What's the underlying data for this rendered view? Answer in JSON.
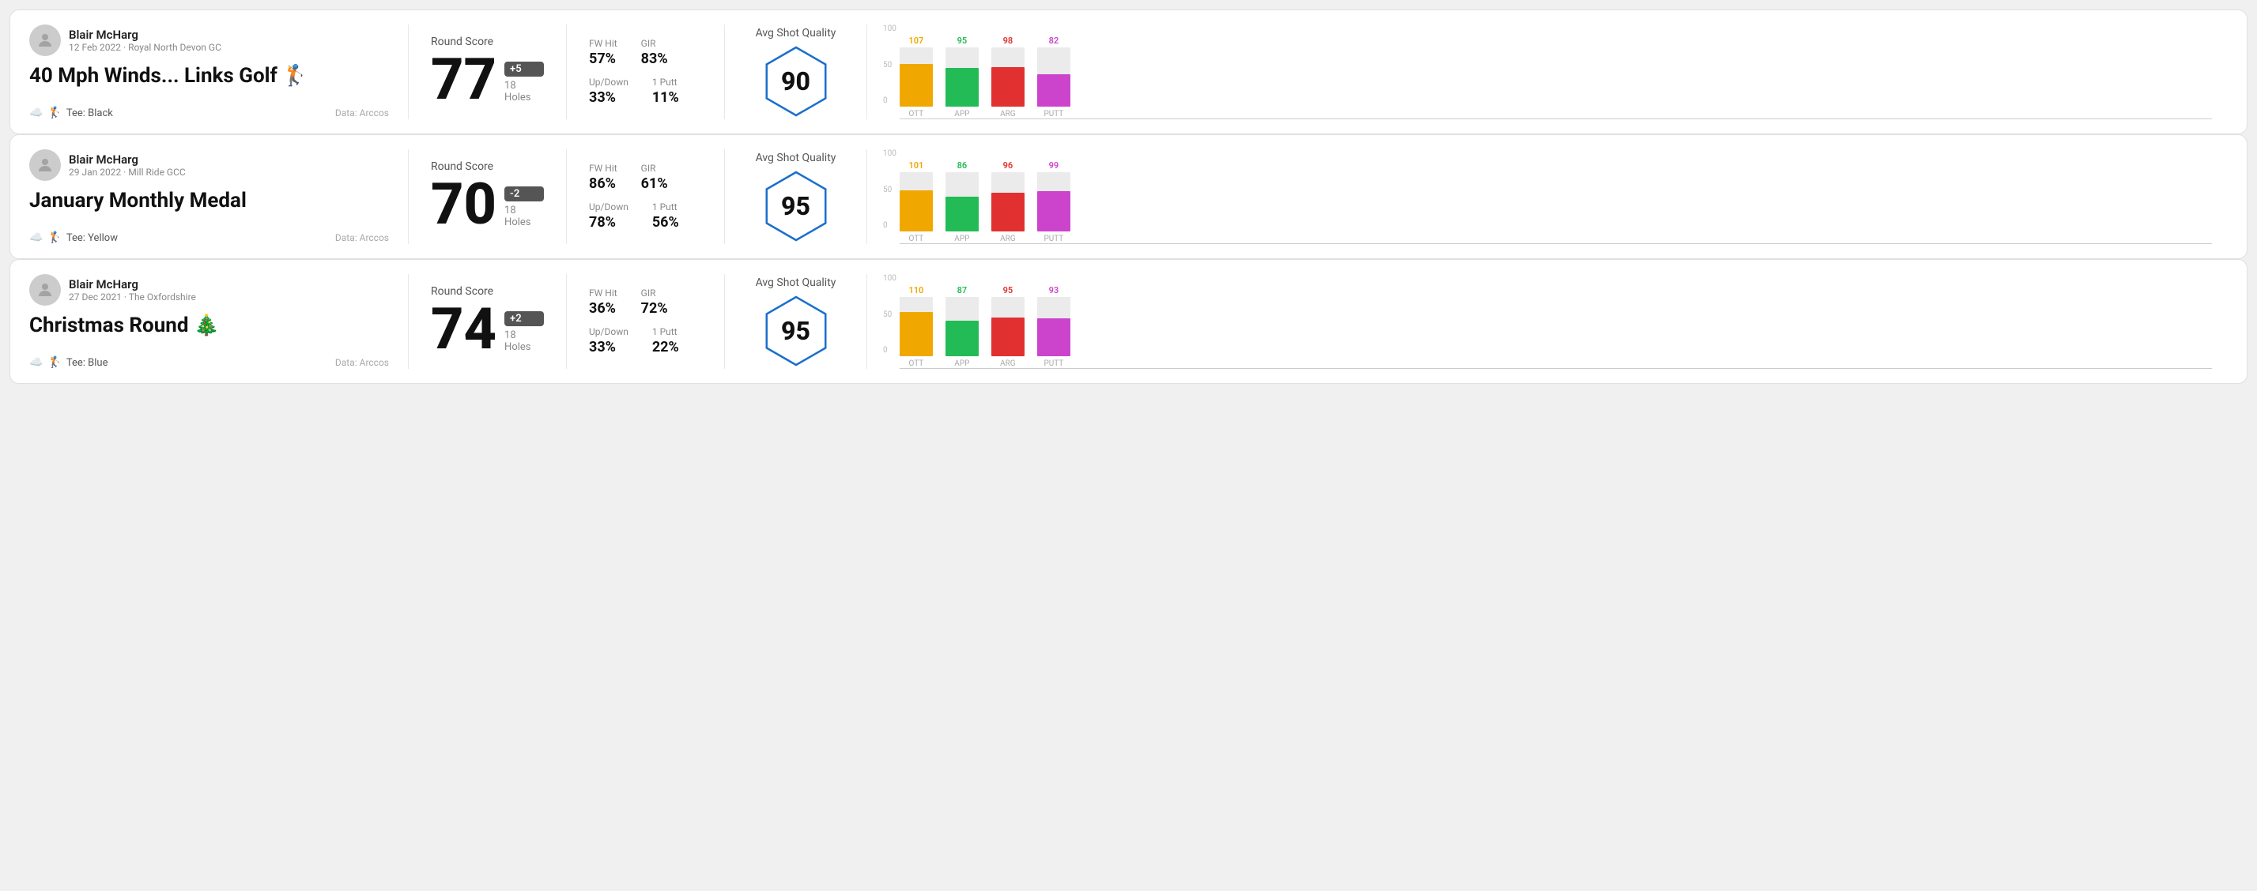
{
  "rounds": [
    {
      "id": "round1",
      "user": {
        "name": "Blair McHarg",
        "date": "12 Feb 2022 · Royal North Devon GC"
      },
      "title": "40 Mph Winds... Links Golf 🏌",
      "tee": "Black",
      "data_source": "Data: Arccos",
      "score": {
        "value": "77",
        "badge": "+5",
        "holes": "18 Holes"
      },
      "stats": {
        "fw_hit": "57%",
        "gir": "83%",
        "up_down": "33%",
        "one_putt": "11%"
      },
      "quality": {
        "label": "Avg Shot Quality",
        "score": "90"
      },
      "chart": {
        "ott": {
          "val": 107,
          "pct": 72
        },
        "app": {
          "val": 95,
          "pct": 65
        },
        "arg": {
          "val": 98,
          "pct": 67
        },
        "putt": {
          "val": 82,
          "pct": 55
        }
      }
    },
    {
      "id": "round2",
      "user": {
        "name": "Blair McHarg",
        "date": "29 Jan 2022 · Mill Ride GCC"
      },
      "title": "January Monthly Medal",
      "tee": "Yellow",
      "data_source": "Data: Arccos",
      "score": {
        "value": "70",
        "badge": "-2",
        "holes": "18 Holes"
      },
      "stats": {
        "fw_hit": "86%",
        "gir": "61%",
        "up_down": "78%",
        "one_putt": "56%"
      },
      "quality": {
        "label": "Avg Shot Quality",
        "score": "95"
      },
      "chart": {
        "ott": {
          "val": 101,
          "pct": 69
        },
        "app": {
          "val": 86,
          "pct": 59
        },
        "arg": {
          "val": 96,
          "pct": 66
        },
        "putt": {
          "val": 99,
          "pct": 68
        }
      }
    },
    {
      "id": "round3",
      "user": {
        "name": "Blair McHarg",
        "date": "27 Dec 2021 · The Oxfordshire"
      },
      "title": "Christmas Round 🎄",
      "tee": "Blue",
      "data_source": "Data: Arccos",
      "score": {
        "value": "74",
        "badge": "+2",
        "holes": "18 Holes"
      },
      "stats": {
        "fw_hit": "36%",
        "gir": "72%",
        "up_down": "33%",
        "one_putt": "22%"
      },
      "quality": {
        "label": "Avg Shot Quality",
        "score": "95"
      },
      "chart": {
        "ott": {
          "val": 110,
          "pct": 75
        },
        "app": {
          "val": 87,
          "pct": 60
        },
        "arg": {
          "val": 95,
          "pct": 65
        },
        "putt": {
          "val": 93,
          "pct": 64
        }
      }
    }
  ],
  "labels": {
    "round_score": "Round Score",
    "fw_hit": "FW Hit",
    "gir": "GIR",
    "up_down": "Up/Down",
    "one_putt": "1 Putt",
    "avg_shot_quality": "Avg Shot Quality",
    "ott": "OTT",
    "app": "APP",
    "arg": "ARG",
    "putt": "PUTT",
    "data_arccos": "Data: Arccos",
    "tee_prefix": "Tee:",
    "y_100": "100",
    "y_50": "50",
    "y_0": "0"
  }
}
